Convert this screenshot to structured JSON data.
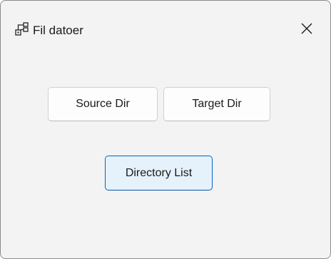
{
  "window": {
    "title": "Fil datoer",
    "icon": "hierarchy-icon",
    "close_icon": "close-icon"
  },
  "buttons": {
    "source_dir": "Source Dir",
    "target_dir": "Target Dir",
    "directory_list": "Directory List"
  },
  "colors": {
    "window_bg": "#f3f3f3",
    "focused_button_bg": "#e5f1fb",
    "focused_button_border": "#0067c0"
  }
}
